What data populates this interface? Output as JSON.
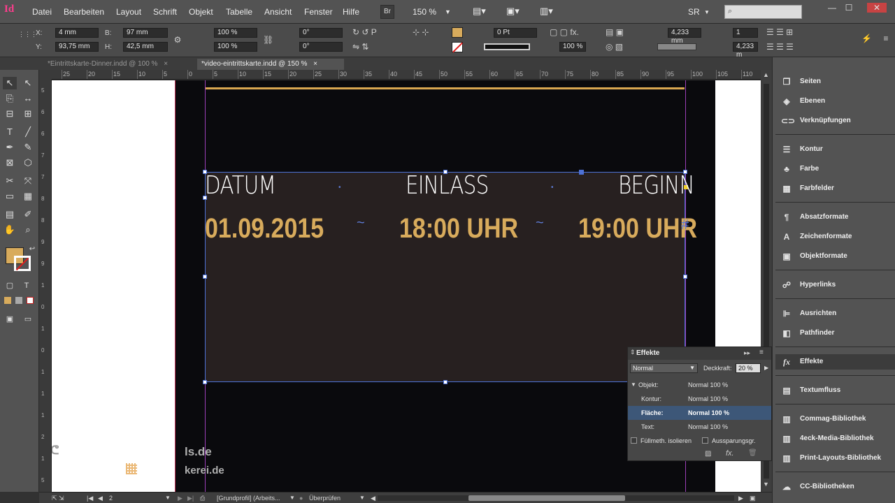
{
  "app": {
    "logo": "Id",
    "menu": [
      "Datei",
      "Bearbeiten",
      "Layout",
      "Schrift",
      "Objekt",
      "Tabelle",
      "Ansicht",
      "Fenster",
      "Hilfe"
    ],
    "bridge_label": "Br",
    "zoom": "150 %",
    "workspace": "SR",
    "window_buttons": [
      "—",
      "☐",
      "✕"
    ]
  },
  "control_bar": {
    "x_label": "X:",
    "x_value": "4 mm",
    "y_label": "Y:",
    "y_value": "93,75 mm",
    "w_label": "B:",
    "w_value": "97 mm",
    "h_label": "H:",
    "h_value": "42,5 mm",
    "scale_x": "100 %",
    "scale_y": "100 %",
    "rotate": "0°",
    "shear": "0°",
    "stroke_weight": "0 Pt",
    "opacity": "100 %",
    "gap_value": "4,233 mm",
    "gap_value2": "4,233 m",
    "columns": "1"
  },
  "tabs": [
    {
      "label": "*Eintrittskarte-Dinner.indd @ 100 %",
      "active": false
    },
    {
      "label": "*video-eintrittskarte.indd @ 150 %",
      "active": true
    }
  ],
  "ruler_top": [
    "25",
    "20",
    "15",
    "10",
    "5",
    "0",
    "5",
    "10",
    "15",
    "20",
    "25",
    "30",
    "35",
    "40",
    "45",
    "50",
    "55",
    "60",
    "65",
    "70",
    "75",
    "80",
    "85",
    "90",
    "95",
    "100",
    "105",
    "110"
  ],
  "ruler_left": [
    "5",
    "6",
    "6",
    "7",
    "7",
    "8",
    "8",
    "9",
    "9",
    "1",
    "0",
    "1",
    "0",
    "1",
    "1",
    "1",
    "2",
    "1",
    "5"
  ],
  "document": {
    "labels": [
      "DATUM",
      "EINLASS",
      "BEGINN"
    ],
    "values": [
      "01.09.2015",
      "18:00 UHR",
      "19:00 UHR"
    ],
    "separator": "~",
    "hash": "#",
    "colors": {
      "gold": "#D8AB5C",
      "frame": "#4D71D6",
      "guide": "#9B3FB8",
      "dark_bg": "#0A0A0D"
    }
  },
  "watermarks": [
    "ls.de",
    "kerei.de"
  ],
  "effects": {
    "title": "Effekte",
    "mode": "Normal",
    "opacity_label": "Deckkraft:",
    "opacity_value": "20 %",
    "rows": [
      {
        "label": "Objekt:",
        "value": "Normal 100 %",
        "selected": false
      },
      {
        "label": "Kontur:",
        "value": "Normal 100 %",
        "selected": false
      },
      {
        "label": "Fläche:",
        "value": "Normal 100 %",
        "selected": true
      },
      {
        "label": "Text:",
        "value": "Normal 100 %",
        "selected": false
      }
    ],
    "isolate": "Füllmeth. isolieren",
    "knockout": "Aussparungsgr."
  },
  "panels": [
    {
      "label": "Seiten",
      "icon": "pages-icon"
    },
    {
      "label": "Ebenen",
      "icon": "layers-icon"
    },
    {
      "label": "Verknüpfungen",
      "icon": "links-icon"
    },
    {
      "label": "Kontur",
      "icon": "stroke-icon"
    },
    {
      "label": "Farbe",
      "icon": "color-icon"
    },
    {
      "label": "Farbfelder",
      "icon": "swatches-icon"
    },
    {
      "label": "Absatzformate",
      "icon": "paragraph-styles-icon"
    },
    {
      "label": "Zeichenformate",
      "icon": "character-styles-icon"
    },
    {
      "label": "Objektformate",
      "icon": "object-styles-icon"
    },
    {
      "label": "Hyperlinks",
      "icon": "hyperlinks-icon"
    },
    {
      "label": "Ausrichten",
      "icon": "align-icon"
    },
    {
      "label": "Pathfinder",
      "icon": "pathfinder-icon"
    },
    {
      "label": "Effekte",
      "icon": "effects-icon"
    },
    {
      "label": "Textumfluss",
      "icon": "text-wrap-icon"
    },
    {
      "label": "Commag-Bibliothek",
      "icon": "library-icon"
    },
    {
      "label": "4eck-Media-Bibliothek",
      "icon": "library-icon"
    },
    {
      "label": "Print-Layouts-Bibliothek",
      "icon": "library-icon"
    },
    {
      "label": "CC-Bibliotheken",
      "icon": "cc-libraries-icon"
    }
  ],
  "status": {
    "page": "2",
    "profile": "[Grundprofil] (Arbeits...",
    "preflight": "Überprüfen"
  }
}
